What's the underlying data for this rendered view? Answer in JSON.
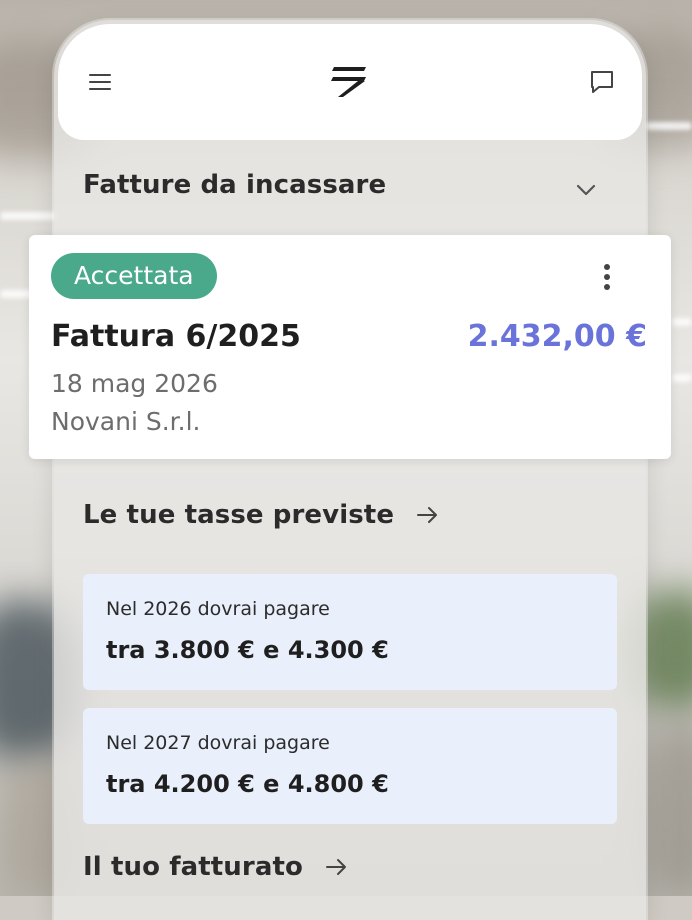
{
  "header": {
    "menu_icon": "hamburger-menu-icon",
    "logo_icon": "brand-logo-icon",
    "chat_icon": "chat-bubble-icon"
  },
  "receivables": {
    "title": "Fatture da incassare",
    "toggle_icon": "chevron-down-icon"
  },
  "invoice": {
    "status": "Accettata",
    "status_color": "#4aa98b",
    "title": "Fattura 6/2025",
    "amount": "2.432,00 €",
    "amount_color": "#6a73d9",
    "date": "18 mag 2026",
    "client": "Novani S.r.l.",
    "menu_icon": "more-vertical-icon"
  },
  "taxes": {
    "title": "Le tue tasse previste",
    "arrow_icon": "arrow-right-icon",
    "items": [
      {
        "label": "Nel 2026 dovrai pagare",
        "range": "tra 3.800 € e 4.300 €"
      },
      {
        "label": "Nel 2027 dovrai pagare",
        "range": "tra 4.200 € e 4.800 €"
      }
    ],
    "card_color": "#e9effb"
  },
  "revenue": {
    "title": "Il tuo fatturato",
    "arrow_icon": "arrow-right-icon"
  }
}
